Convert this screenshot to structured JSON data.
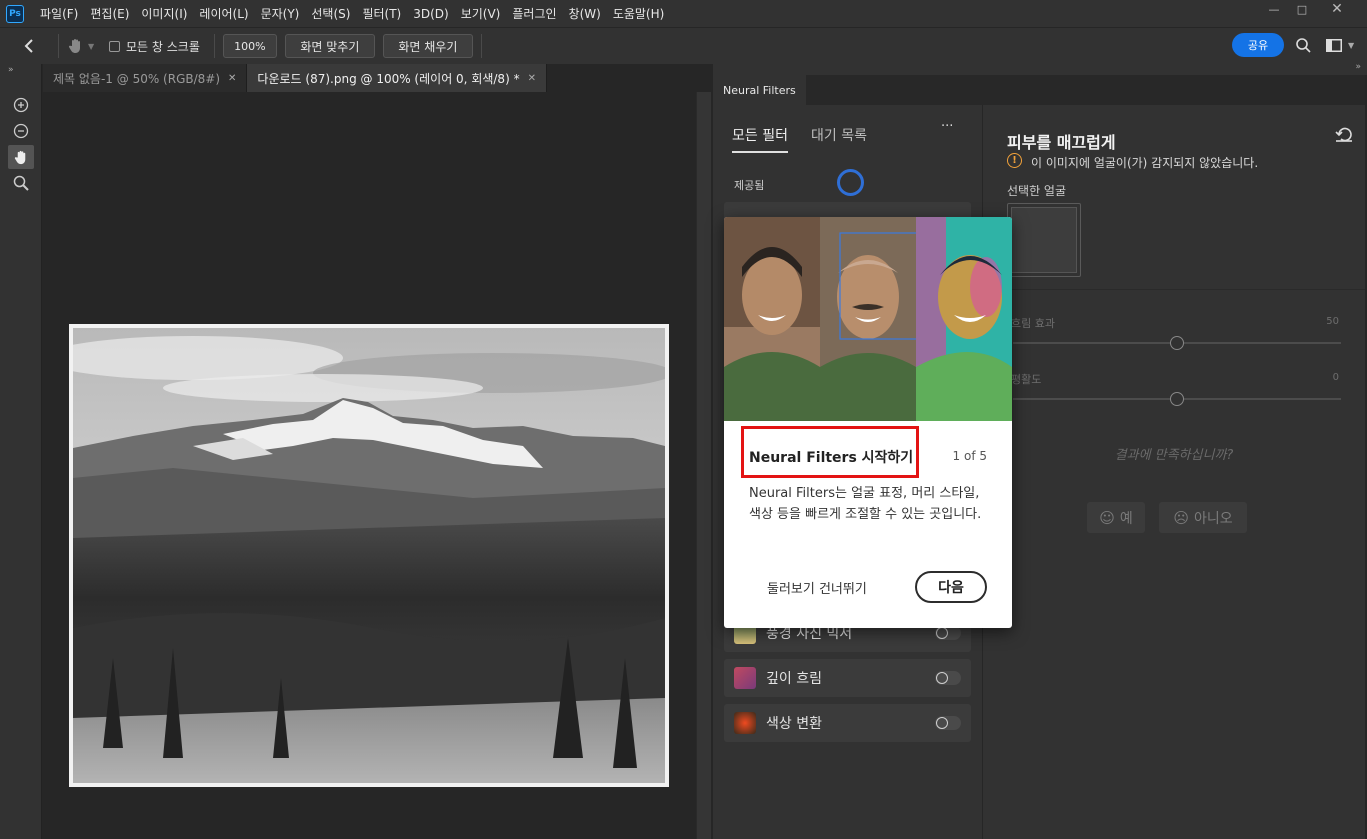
{
  "app": {
    "logo": "Ps"
  },
  "menu": [
    "파일(F)",
    "편집(E)",
    "이미지(I)",
    "레이어(L)",
    "문자(Y)",
    "선택(S)",
    "필터(T)",
    "3D(D)",
    "보기(V)",
    "플러그인",
    "창(W)",
    "도움말(H)"
  ],
  "options": {
    "scroll_all_label": "모든 창 스크롤",
    "zoom_value": "100%",
    "fit_screen_label": "화면 맞추기",
    "fill_screen_label": "화면 채우기",
    "share_label": "공유"
  },
  "doc_tabs": [
    {
      "label": "제목 없음-1 @ 50% (RGB/8#)"
    },
    {
      "label": "다운로드 (87).png @ 100% (레이어 0, 회색/8) *"
    }
  ],
  "neural_filters": {
    "panel_tab": "Neural Filters",
    "tab_all": "모든 필터",
    "tab_waitlist": "대기 목록",
    "more": "···",
    "section_featured": "제공됨",
    "filters": [
      {
        "label": "풍경 사진 믹서"
      },
      {
        "label": "깊이 흐림"
      },
      {
        "label": "색상 변환"
      }
    ],
    "right": {
      "title": "피부를 매끄럽게",
      "warning": "이 이미지에 얼굴이(가) 감지되지 않았습니다.",
      "selected_face_label": "선택한 얼굴",
      "blur_label": "흐림 효과",
      "blur_value": "50",
      "smoothness_label": "평활도",
      "smoothness_value": "0",
      "feedback_question": "결과에 만족하십니까?",
      "yes_label": "예",
      "no_label": "아니오"
    }
  },
  "popup": {
    "title": "Neural Filters 시작하기",
    "counter": "1 of 5",
    "body": "Neural Filters는 얼굴 표정, 머리 스타일, 색상 등을 빠르게 조절할 수 있는 곳입니다.",
    "skip_label": "둘러보기 건너뛰기",
    "next_label": "다음"
  }
}
